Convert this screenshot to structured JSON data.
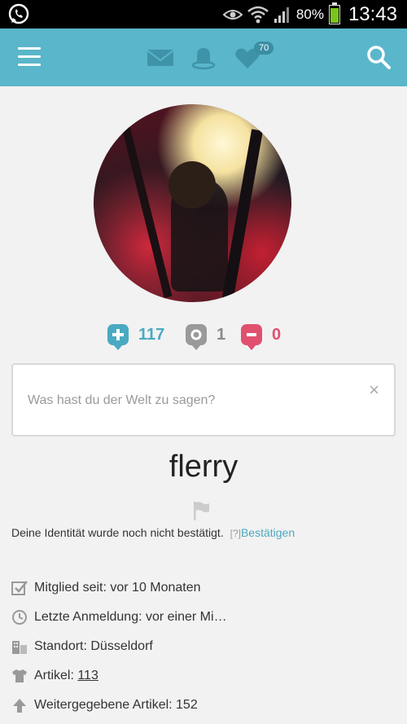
{
  "status_bar": {
    "battery": "80%",
    "time": "13:43",
    "battery_level": 0.8,
    "icons": [
      "whatsapp-icon",
      "eye-icon",
      "wifi-icon",
      "signal-icon",
      "battery-icon"
    ]
  },
  "header": {
    "icons": [
      "menu-icon",
      "mail-icon",
      "bell-icon",
      "heart-icon",
      "search-icon"
    ],
    "favorites_badge": "70",
    "accent": "#5ab6ca"
  },
  "profile": {
    "stats": {
      "positive": "117",
      "neutral": "1",
      "negative": "0"
    },
    "compose_placeholder": "Was hast du der Welt zu sagen?",
    "close_symbol": "×",
    "username": "flerry",
    "identity_text": "Deine Identität wurde noch nicht bestätigt.",
    "identity_help": "[?]",
    "identity_verify": "Bestätigen"
  },
  "info": {
    "member_since": "Mitglied seit: vor 10 Monaten",
    "last_login": "Letzte Anmeldung: vor einer Mi…",
    "location": "Standort: Düsseldorf",
    "items_label": "Artikel: ",
    "items_count": "113",
    "passed_items": "Weitergegebene Artikel: 152"
  },
  "colors": {
    "positive": "#4aa9c2",
    "neutral": "#9a9a9a",
    "negative": "#e0506f"
  }
}
